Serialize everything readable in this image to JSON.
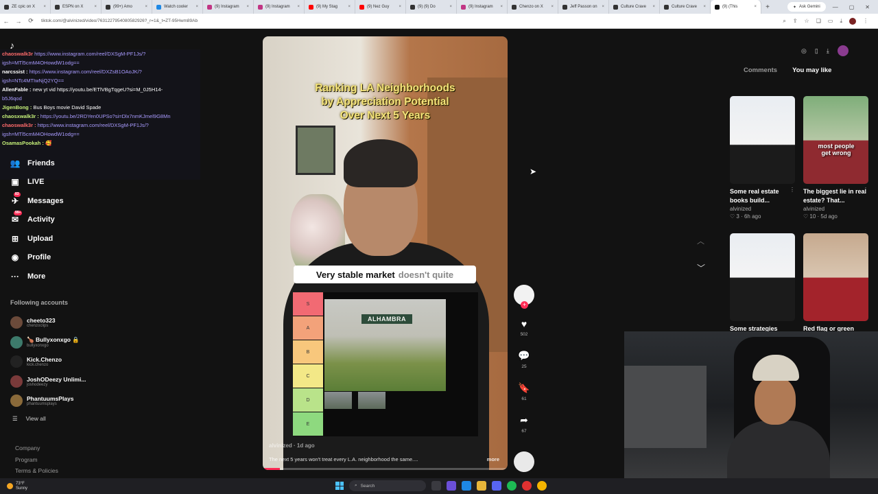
{
  "browser": {
    "tabs": [
      {
        "label": "ZE cpic on X",
        "color": "#333333"
      },
      {
        "label": "ESPN on X",
        "color": "#333333"
      },
      {
        "label": "(99+) Amo",
        "color": "#333333"
      },
      {
        "label": "Watch cooler",
        "color": "#1e88e5"
      },
      {
        "label": "(9) Instagram",
        "color": "#c13584"
      },
      {
        "label": "(9) Instagram",
        "color": "#c13584"
      },
      {
        "label": "(9) My Stag",
        "color": "#ff0000"
      },
      {
        "label": "(9) Nez Guy",
        "color": "#ff0000"
      },
      {
        "label": "(9) (9) Do",
        "color": "#333333"
      },
      {
        "label": "(9) Instagram",
        "color": "#c13584"
      },
      {
        "label": "Chenzo on X",
        "color": "#333333"
      },
      {
        "label": "Jeff Passon on",
        "color": "#333333"
      },
      {
        "label": "Culture Crave",
        "color": "#333333"
      },
      {
        "label": "Culture Crave",
        "color": "#333333"
      },
      {
        "label": "(9) (This",
        "color": "#111111"
      }
    ],
    "new_tab": "+",
    "gemini": "Ask Gemini",
    "url": "tiktok.com/@alvinized/video/7631227954080582926?_r=1&_t=ZT-95Hwm89Ab"
  },
  "sidebar": {
    "logo": "♪",
    "chat": [
      {
        "user": "chaoswalk3r",
        "user_class": "r",
        "link": "https://www.instagram.com/reel/DXSgM-PF1Js/?",
        "msg": ""
      },
      {
        "user": "",
        "user_class": "",
        "link": "igsh=MTl5cmM4OHowdW1odg==",
        "msg": ""
      },
      {
        "user": "narcssist :",
        "user_class": "",
        "link": "https://www.instagram.com/reel/DXZsB1OAoJK/?",
        "msg": ""
      },
      {
        "user": "",
        "user_class": "",
        "link": "igsh=NTc4MTIwNjQ2YQ==",
        "msg": ""
      },
      {
        "user": "AllenFable :",
        "user_class": "",
        "link": "",
        "msg": "new yt vid https://youtu.be/ETlVBgTqgeU?si=M_0J5H14-"
      },
      {
        "user": "",
        "user_class": "",
        "link": "b5J6qod",
        "msg": ""
      },
      {
        "user": "JigenBong :",
        "user_class": "g",
        "link": "",
        "msg": "Bus Boys movie David Spade"
      },
      {
        "user": "chaosxwalk3r :",
        "user_class": "g",
        "link": "https://youtu.be/2RDYen0UPSo?si=Dlx7nmKJmel9G8Mn",
        "msg": ""
      },
      {
        "user": "chaoswalk3r :",
        "user_class": "r",
        "link": "https://www.instagram.com/reel/DXSgM-PF1Js/?",
        "msg": ""
      },
      {
        "user": "",
        "user_class": "",
        "link": "igsh=MTl5cmM4OHowdW1odg==",
        "msg": ""
      },
      {
        "user": "OsamasPookah :",
        "user_class": "g",
        "link": "",
        "msg": "🥰"
      }
    ],
    "nav": [
      {
        "label": "Friends",
        "icon": "👥",
        "badge": ""
      },
      {
        "label": "LIVE",
        "icon": "▣",
        "badge": ""
      },
      {
        "label": "Messages",
        "icon": "✈",
        "badge": "83"
      },
      {
        "label": "Activity",
        "icon": "✉",
        "badge": "99+"
      },
      {
        "label": "Upload",
        "icon": "⊞",
        "badge": ""
      },
      {
        "label": "Profile",
        "icon": "◉",
        "badge": ""
      },
      {
        "label": "More",
        "icon": "···",
        "badge": ""
      }
    ],
    "following_header": "Following accounts",
    "accounts": [
      {
        "name": "cheeto323",
        "handle": "chenzoclips",
        "color": "#6b4a3a"
      },
      {
        "name": "🍗 Bullyxonxgo 🔒",
        "handle": "bullyxonxgo",
        "color": "#3d7a6b"
      },
      {
        "name": "Kick.Chenzo",
        "handle": "kick.chenzo",
        "color": "#222222"
      },
      {
        "name": "JoshODeezy Unlimi...",
        "handle": "joshodeezy",
        "color": "#7a3a3a"
      },
      {
        "name": "PhantuumsPlays",
        "handle": "phantuumsplays",
        "color": "#8a6a3a"
      }
    ],
    "view_all": "View all",
    "footer": [
      "Company",
      "Program",
      "Terms & Policies"
    ]
  },
  "video": {
    "title_lines": [
      "Ranking LA Neighborhoods",
      "by Appreciation Potential",
      "Over Next 5 Years"
    ],
    "caption_bold": "Very stable market",
    "caption_dim": "doesn't quite",
    "tiers": [
      "S",
      "A",
      "B",
      "C",
      "D",
      "E"
    ],
    "tier_colors": [
      "#f26a73",
      "#f3a27a",
      "#f8c77c",
      "#f3e887",
      "#b9e38a",
      "#8ed97f"
    ],
    "sign_text": "ALHAMBRA",
    "username": "alvinized · 1d ago",
    "description": "The next 5 years won't treat every L.A. neighborhood the same....",
    "more": "more",
    "progress": 0.07
  },
  "actions": {
    "likes": "502",
    "comments": "25",
    "saves": "61",
    "shares": "67"
  },
  "right": {
    "tabs": [
      "Comments",
      "You may like"
    ],
    "cards": [
      {
        "caption": "Some real estate books build...",
        "author": "alvinized",
        "meta": "♡ 3 · 6h ago",
        "overlay": "",
        "bg": "linear-gradient(180deg,#e9edf2,#f4f4f4 55%,#1b1b1b 56%)"
      },
      {
        "caption": "The biggest lie in real estate? That...",
        "author": "alvinized",
        "meta": "♡ 10 · 5d ago",
        "overlay": "most people get wrong",
        "bg": "linear-gradient(180deg,#7fae7a,#b5c7a5 50%,#8f2a30 51%)"
      },
      {
        "caption": "Some strategies",
        "author": "",
        "meta": "",
        "overlay": "",
        "bg": "linear-gradient(180deg,#e9edf2,#f4f4f4 50%,#1b1b1b 51%)"
      },
      {
        "caption": "Red flag or green",
        "author": "",
        "meta": "",
        "overlay": "",
        "bg": "linear-gradient(180deg,#c6a98e,#d9c6b1 50%,#a3232b 51%)"
      }
    ]
  },
  "taskbar": {
    "temp": "73°F",
    "weather": "Sunny",
    "search": "Search"
  }
}
